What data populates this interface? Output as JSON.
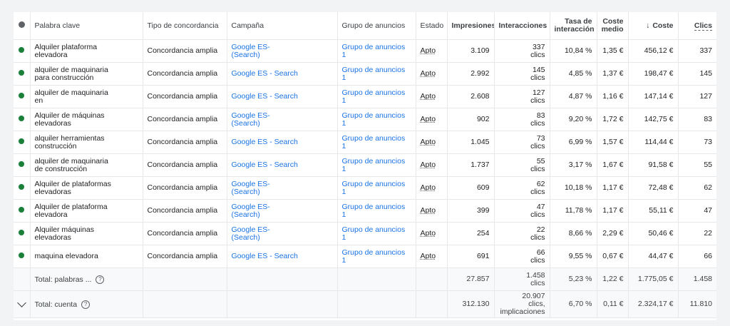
{
  "columns": {
    "keyword": "Palabra clave",
    "match_type": "Tipo de concordancia",
    "campaign": "Campaña",
    "ad_group": "Grupo de anuncios",
    "status": "Estado",
    "impressions": "Impresiones",
    "interactions": "Interacciones",
    "interaction_rate_1": "Tasa de",
    "interaction_rate_2": "interacción",
    "avg_cost_1": "Coste",
    "avg_cost_2": "medio",
    "cost_arrow": "↓",
    "cost": "Coste",
    "clicks": "Clics"
  },
  "rows": [
    {
      "keyword_1": "Alquiler plataforma",
      "keyword_2": "elevadora",
      "match": "Concordancia amplia",
      "campaign_1": "Google ES-",
      "campaign_2": "(Search)",
      "ad_group": "Grupo de anuncios 1",
      "status": "Apto",
      "impressions": "3.109",
      "interactions_1": "337",
      "interactions_2": "clics",
      "rate": "10,84 %",
      "avg_cost": "1,35 €",
      "cost": "456,12 €",
      "clicks": "337"
    },
    {
      "keyword_1": "alquiler de maquinaria",
      "keyword_2": "para construcción",
      "match": "Concordancia amplia",
      "campaign_1": "Google ES - Search",
      "campaign_2": "",
      "ad_group": "Grupo de anuncios 1",
      "status": "Apto",
      "impressions": "2.992",
      "interactions_1": "145",
      "interactions_2": "clics",
      "rate": "4,85 %",
      "avg_cost": "1,37 €",
      "cost": "198,47 €",
      "clicks": "145"
    },
    {
      "keyword_1": "alquiler de maquinaria",
      "keyword_2": "en",
      "match": "Concordancia amplia",
      "campaign_1": "Google ES - Search",
      "campaign_2": "",
      "ad_group": "Grupo de anuncios 1",
      "status": "Apto",
      "impressions": "2.608",
      "interactions_1": "127",
      "interactions_2": "clics",
      "rate": "4,87 %",
      "avg_cost": "1,16 €",
      "cost": "147,14 €",
      "clicks": "127"
    },
    {
      "keyword_1": "Alquiler de máquinas",
      "keyword_2": "elevadoras",
      "match": "Concordancia amplia",
      "campaign_1": "Google ES-",
      "campaign_2": "(Search)",
      "ad_group": "Grupo de anuncios 1",
      "status": "Apto",
      "impressions": "902",
      "interactions_1": "83",
      "interactions_2": "clics",
      "rate": "9,20 %",
      "avg_cost": "1,72 €",
      "cost": "142,75 €",
      "clicks": "83"
    },
    {
      "keyword_1": "alquiler herramientas",
      "keyword_2": "construcción",
      "match": "Concordancia amplia",
      "campaign_1": "Google ES - Search",
      "campaign_2": "",
      "ad_group": "Grupo de anuncios 1",
      "status": "Apto",
      "impressions": "1.045",
      "interactions_1": "73",
      "interactions_2": "clics",
      "rate": "6,99 %",
      "avg_cost": "1,57 €",
      "cost": "114,44 €",
      "clicks": "73"
    },
    {
      "keyword_1": "alquiler de maquinaria",
      "keyword_2": "de construcción",
      "match": "Concordancia amplia",
      "campaign_1": "Google ES - Search",
      "campaign_2": "",
      "ad_group": "Grupo de anuncios 1",
      "status": "Apto",
      "impressions": "1.737",
      "interactions_1": "55",
      "interactions_2": "clics",
      "rate": "3,17 %",
      "avg_cost": "1,67 €",
      "cost": "91,58 €",
      "clicks": "55"
    },
    {
      "keyword_1": "Alquiler de plataformas",
      "keyword_2": "elevadoras",
      "match": "Concordancia amplia",
      "campaign_1": "Google ES-",
      "campaign_2": "(Search)",
      "ad_group": "Grupo de anuncios 1",
      "status": "Apto",
      "impressions": "609",
      "interactions_1": "62",
      "interactions_2": "clics",
      "rate": "10,18 %",
      "avg_cost": "1,17 €",
      "cost": "72,48 €",
      "clicks": "62"
    },
    {
      "keyword_1": "Alquiler de plataforma",
      "keyword_2": "elevadora",
      "match": "Concordancia amplia",
      "campaign_1": "Google ES-",
      "campaign_2": "(Search)",
      "ad_group": "Grupo de anuncios 1",
      "status": "Apto",
      "impressions": "399",
      "interactions_1": "47",
      "interactions_2": "clics",
      "rate": "11,78 %",
      "avg_cost": "1,17 €",
      "cost": "55,11 €",
      "clicks": "47"
    },
    {
      "keyword_1": "Alquiler máquinas",
      "keyword_2": "elevadoras",
      "match": "Concordancia amplia",
      "campaign_1": "Google ES-",
      "campaign_2": "(Search)",
      "ad_group": "Grupo de anuncios 1",
      "status": "Apto",
      "impressions": "254",
      "interactions_1": "22",
      "interactions_2": "clics",
      "rate": "8,66 %",
      "avg_cost": "2,29 €",
      "cost": "50,46 €",
      "clicks": "22"
    },
    {
      "keyword_1": "maquina elevadora",
      "keyword_2": "",
      "match": "Concordancia amplia",
      "campaign_1": "Google ES - Search",
      "campaign_2": "",
      "ad_group": "Grupo de anuncios 1",
      "status": "Apto",
      "impressions": "691",
      "interactions_1": "66",
      "interactions_2": "clics",
      "rate": "9,55 %",
      "avg_cost": "0,67 €",
      "cost": "44,47 €",
      "clicks": "66"
    }
  ],
  "total_keywords": {
    "label": "Total: palabras ...",
    "impressions": "27.857",
    "interactions_1": "1.458",
    "interactions_2": "clics",
    "rate": "5,23 %",
    "avg_cost": "1,22 €",
    "cost": "1.775,05 €",
    "clicks": "1.458"
  },
  "total_account": {
    "label": "Total: cuenta",
    "impressions": "312.130",
    "interactions_1": "20.907",
    "interactions_2": "clics,",
    "interactions_3": "implicaciones",
    "rate": "6,70 %",
    "avg_cost": "0,11 €",
    "cost": "2.324,17 €",
    "clicks": "11.810"
  },
  "help_glyph": "?",
  "colors": {
    "enabled_dot": "#188038",
    "link": "#1a73e8"
  },
  "icons": {
    "status_header": "status-dot-icon",
    "help": "help-icon",
    "expand": "chevron-down-icon"
  }
}
